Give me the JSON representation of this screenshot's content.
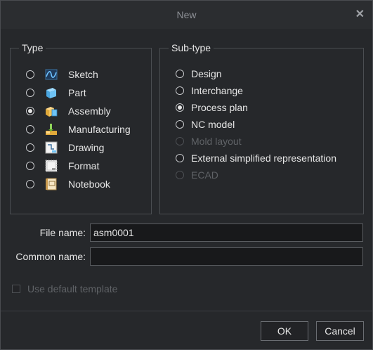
{
  "window": {
    "title": "New",
    "close_glyph": "✕"
  },
  "type_group": {
    "legend": "Type",
    "items": [
      {
        "label": "Sketch",
        "icon": "sketch-icon",
        "selected": false
      },
      {
        "label": "Part",
        "icon": "part-icon",
        "selected": false
      },
      {
        "label": "Assembly",
        "icon": "assembly-icon",
        "selected": true
      },
      {
        "label": "Manufacturing",
        "icon": "manufacturing-icon",
        "selected": false
      },
      {
        "label": "Drawing",
        "icon": "drawing-icon",
        "selected": false
      },
      {
        "label": "Format",
        "icon": "format-icon",
        "selected": false
      },
      {
        "label": "Notebook",
        "icon": "notebook-icon",
        "selected": false
      }
    ]
  },
  "subtype_group": {
    "legend": "Sub-type",
    "items": [
      {
        "label": "Design",
        "selected": false,
        "enabled": true
      },
      {
        "label": "Interchange",
        "selected": false,
        "enabled": true
      },
      {
        "label": "Process plan",
        "selected": true,
        "enabled": true
      },
      {
        "label": "NC model",
        "selected": false,
        "enabled": true
      },
      {
        "label": "Mold layout",
        "selected": false,
        "enabled": false
      },
      {
        "label": "External simplified representation",
        "selected": false,
        "enabled": true
      },
      {
        "label": "ECAD",
        "selected": false,
        "enabled": false
      }
    ]
  },
  "fields": {
    "file_name": {
      "label": "File name:",
      "value": "asm0001"
    },
    "common_name": {
      "label": "Common name:",
      "value": ""
    }
  },
  "options": {
    "use_default_template": {
      "label": "Use default template",
      "checked": false,
      "enabled": false
    }
  },
  "buttons": {
    "ok": "OK",
    "cancel": "Cancel"
  }
}
